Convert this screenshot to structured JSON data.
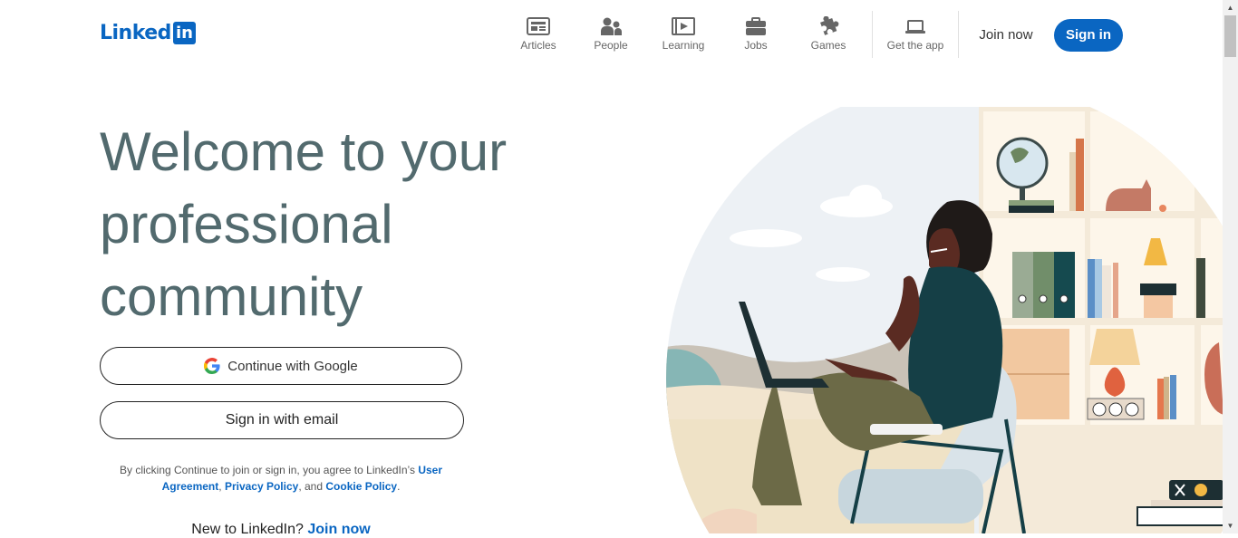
{
  "header": {
    "logo_text": "Linked",
    "logo_box": "in",
    "nav": [
      {
        "label": "Articles",
        "icon": "articles-icon"
      },
      {
        "label": "People",
        "icon": "people-icon"
      },
      {
        "label": "Learning",
        "icon": "learning-icon"
      },
      {
        "label": "Jobs",
        "icon": "jobs-icon"
      },
      {
        "label": "Games",
        "icon": "games-icon"
      },
      {
        "label": "Get the app",
        "icon": "laptop-icon"
      }
    ],
    "join_now": "Join now",
    "sign_in": "Sign in"
  },
  "hero": {
    "headline": "Welcome to your professional community",
    "google_button": "Continue with Google",
    "email_button": "Sign in with email",
    "legal": {
      "prefix": "By clicking Continue to join or sign in, you agree to LinkedIn’s",
      "user_agreement": "User Agreement",
      "privacy_policy": "Privacy Policy",
      "and": ", and",
      "cookie_policy": "Cookie Policy"
    },
    "new_to": "New to LinkedIn?",
    "join_now_link": "Join now"
  },
  "colors": {
    "brand": "#0a66c2",
    "headline": "#526a6e"
  }
}
